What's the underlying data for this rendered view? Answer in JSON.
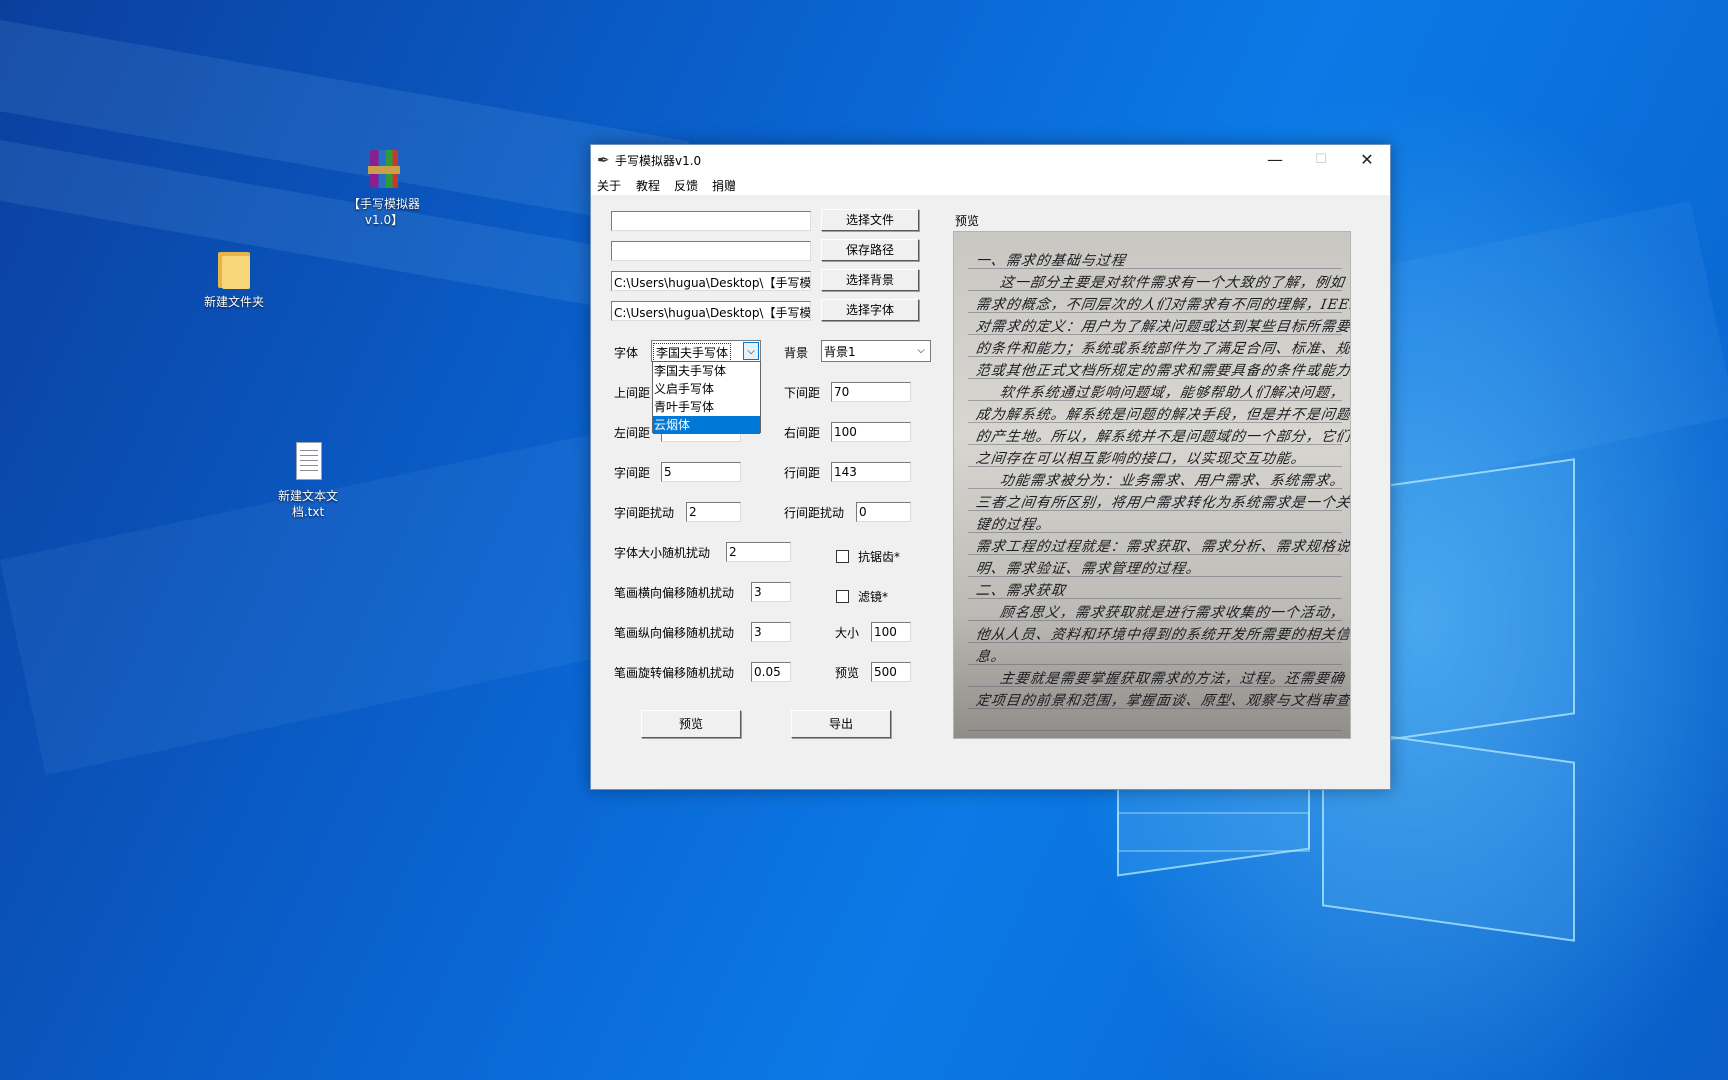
{
  "desktop": {
    "icons": [
      {
        "label": "【手写模拟器v1.0】",
        "icon": "winrar-archive-icon"
      },
      {
        "label": "新建文件夹",
        "icon": "folder-icon"
      },
      {
        "label": "新建文本文档.txt",
        "icon": "text-file-icon"
      }
    ]
  },
  "window": {
    "title": "手写模拟器v1.0",
    "icon": "feather-icon",
    "controls": {
      "minimize": "—",
      "maximize": "☐",
      "close": "✕"
    }
  },
  "menu": {
    "items": [
      "关于",
      "教程",
      "反馈",
      "捐赠"
    ]
  },
  "paths": {
    "text_file_value": "",
    "save_path_value": "",
    "background_value": "C:\\Users\\hugua\\Desktop\\【手写模",
    "font_value": "C:\\Users\\hugua\\Desktop\\【手写模"
  },
  "buttons": {
    "select_file": "选择文件",
    "save_path": "保存路径",
    "select_background": "选择背景",
    "select_font": "选择字体",
    "preview": "预览",
    "export": "导出"
  },
  "font_select": {
    "label": "字体",
    "selected": "李国夫手写体",
    "options": [
      "李国夫手写体",
      "义启手写体",
      "青叶手写体",
      "云烟体"
    ],
    "highlighted_index": 3
  },
  "background_select": {
    "label": "背景",
    "selected": "背景1"
  },
  "fields": {
    "top_margin": {
      "label": "上间距",
      "value": ""
    },
    "bottom_margin": {
      "label": "下间距",
      "value": "70"
    },
    "left_margin": {
      "label": "左间距",
      "value": ""
    },
    "right_margin": {
      "label": "右间距",
      "value": "100"
    },
    "char_spacing": {
      "label": "字间距",
      "value": "5"
    },
    "line_spacing": {
      "label": "行间距",
      "value": "143"
    },
    "char_spacing_jitter": {
      "label": "字间距扰动",
      "value": "2"
    },
    "line_spacing_jitter": {
      "label": "行间距扰动",
      "value": "0"
    },
    "font_size_jitter": {
      "label": "字体大小随机扰动",
      "value": "2"
    },
    "stroke_h_jitter": {
      "label": "笔画横向偏移随机扰动",
      "value": "3"
    },
    "stroke_v_jitter": {
      "label": "笔画纵向偏移随机扰动",
      "value": "3"
    },
    "stroke_rot_jitter": {
      "label": "笔画旋转偏移随机扰动",
      "value": "0.05"
    },
    "size": {
      "label": "大小",
      "value": "100"
    },
    "preview_size": {
      "label": "预览",
      "value": "500"
    }
  },
  "checkboxes": {
    "antialias": {
      "label": "抗锯齿*",
      "checked": false
    },
    "filter": {
      "label": "滤镜*",
      "checked": false
    }
  },
  "preview": {
    "label": "预览",
    "handwriting_lines": [
      "一、需求的基础与过程",
      "这一部分主要是对软件需求有一个大致的了解，例如",
      "需求的概念，不同层次的人们对需求有不同的理解，IEEE",
      "对需求的定义：用户为了解决问题或达到某些目标所需要",
      "的条件和能力；系统或系统部件为了满足合同、标准、规",
      "范或其他正式文档所规定的需求和需要具备的条件或能力。",
      "软件系统通过影响问题域，能够帮助人们解决问题，",
      "成为解系统。解系统是问题的解决手段，但是并不是问题",
      "的产生地。所以，解系统并不是问题域的一个部分，它们",
      "之间存在可以相互影响的接口，以实现交互功能。",
      "功能需求被分为：业务需求、用户需求、系统需求。",
      "三者之间有所区别，将用户需求转化为系统需求是一个关",
      "键的过程。",
      "需求工程的过程就是：需求获取、需求分析、需求规格说",
      "明、需求验证、需求管理的过程。",
      "二、需求获取",
      "顾名思义，需求获取就是进行需求收集的一个活动，",
      "他从人员、资料和环境中得到的系统开发所需要的相关信",
      "息。",
      "主要就是需要掌握获取需求的方法，过程。还需要确",
      "定项目的前景和范围，掌握面谈、原型、观察与文档审查"
    ]
  },
  "colors": {
    "desktop_blue": "#0a63d0",
    "window_bg": "#f0f0f0",
    "selection_blue": "#0078d7"
  }
}
